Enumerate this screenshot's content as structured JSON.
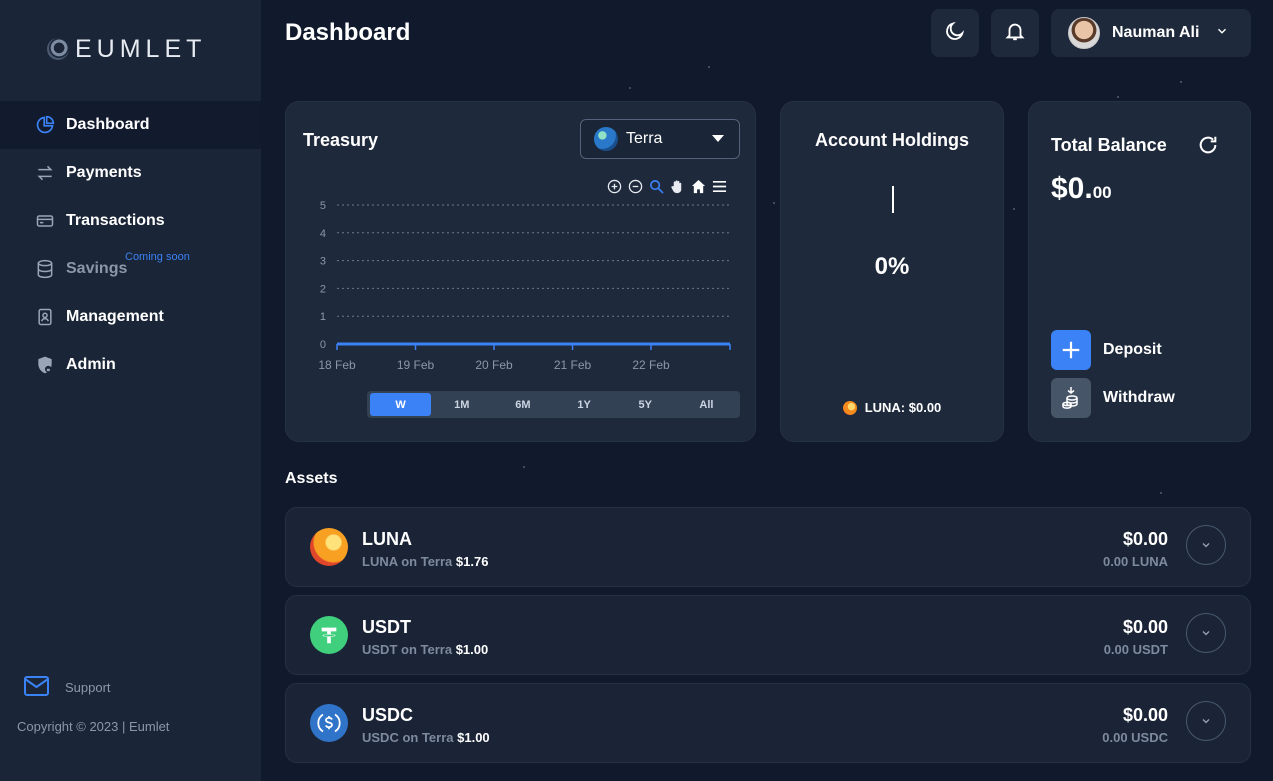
{
  "brand": {
    "name": "EUMLET"
  },
  "sidebar": {
    "items": [
      {
        "label": "Dashboard",
        "icon": "pie-chart-icon",
        "active": true
      },
      {
        "label": "Payments",
        "icon": "transfer-arrows-icon"
      },
      {
        "label": "Transactions",
        "icon": "card-icon"
      },
      {
        "label": "Savings",
        "icon": "database-icon",
        "badge": "Coming soon",
        "disabled": true
      },
      {
        "label": "Management",
        "icon": "contact-book-icon"
      },
      {
        "label": "Admin",
        "icon": "shield-lock-icon"
      }
    ],
    "support_label": "Support",
    "copyright": "Copyright © 2023 | Eumlet"
  },
  "header": {
    "title": "Dashboard",
    "user_name": "Nauman Ali"
  },
  "treasury": {
    "title": "Treasury",
    "chain": "Terra",
    "ranges": [
      "W",
      "1M",
      "6M",
      "1Y",
      "5Y",
      "All"
    ],
    "active_range": "W"
  },
  "chart_data": {
    "type": "area",
    "categories": [
      "18 Feb",
      "19 Feb",
      "20 Feb",
      "21 Feb",
      "22 Feb"
    ],
    "yticks": [
      "0",
      "1",
      "2",
      "3",
      "4",
      "5"
    ],
    "ylim": [
      0,
      5
    ],
    "values": [
      0,
      0,
      0,
      0,
      0,
      0
    ],
    "grid": true,
    "color": "#3b82f6"
  },
  "holdings": {
    "title": "Account Holdings",
    "percent": "0%",
    "legend": "LUNA: $0.00"
  },
  "balance": {
    "title": "Total Balance",
    "amount_main": "$0.",
    "amount_cents": "00",
    "deposit_label": "Deposit",
    "withdraw_label": "Withdraw"
  },
  "assets": {
    "title": "Assets",
    "rows": [
      {
        "name": "LUNA",
        "network": "LUNA on Terra",
        "price": "$1.76",
        "usd": "$0.00",
        "amount": "0.00 LUNA",
        "icon": "luna-icon"
      },
      {
        "name": "USDT",
        "network": "USDT on Terra",
        "price": "$1.00",
        "usd": "$0.00",
        "amount": "0.00 USDT",
        "icon": "tether-icon"
      },
      {
        "name": "USDC",
        "network": "USDC on Terra",
        "price": "$1.00",
        "usd": "$0.00",
        "amount": "0.00 USDC",
        "icon": "usdc-icon"
      }
    ]
  },
  "colors": {
    "accent": "#3b82f6",
    "bg": "#111a2c",
    "card": "#1e293b",
    "sidebar": "#1a2537"
  }
}
